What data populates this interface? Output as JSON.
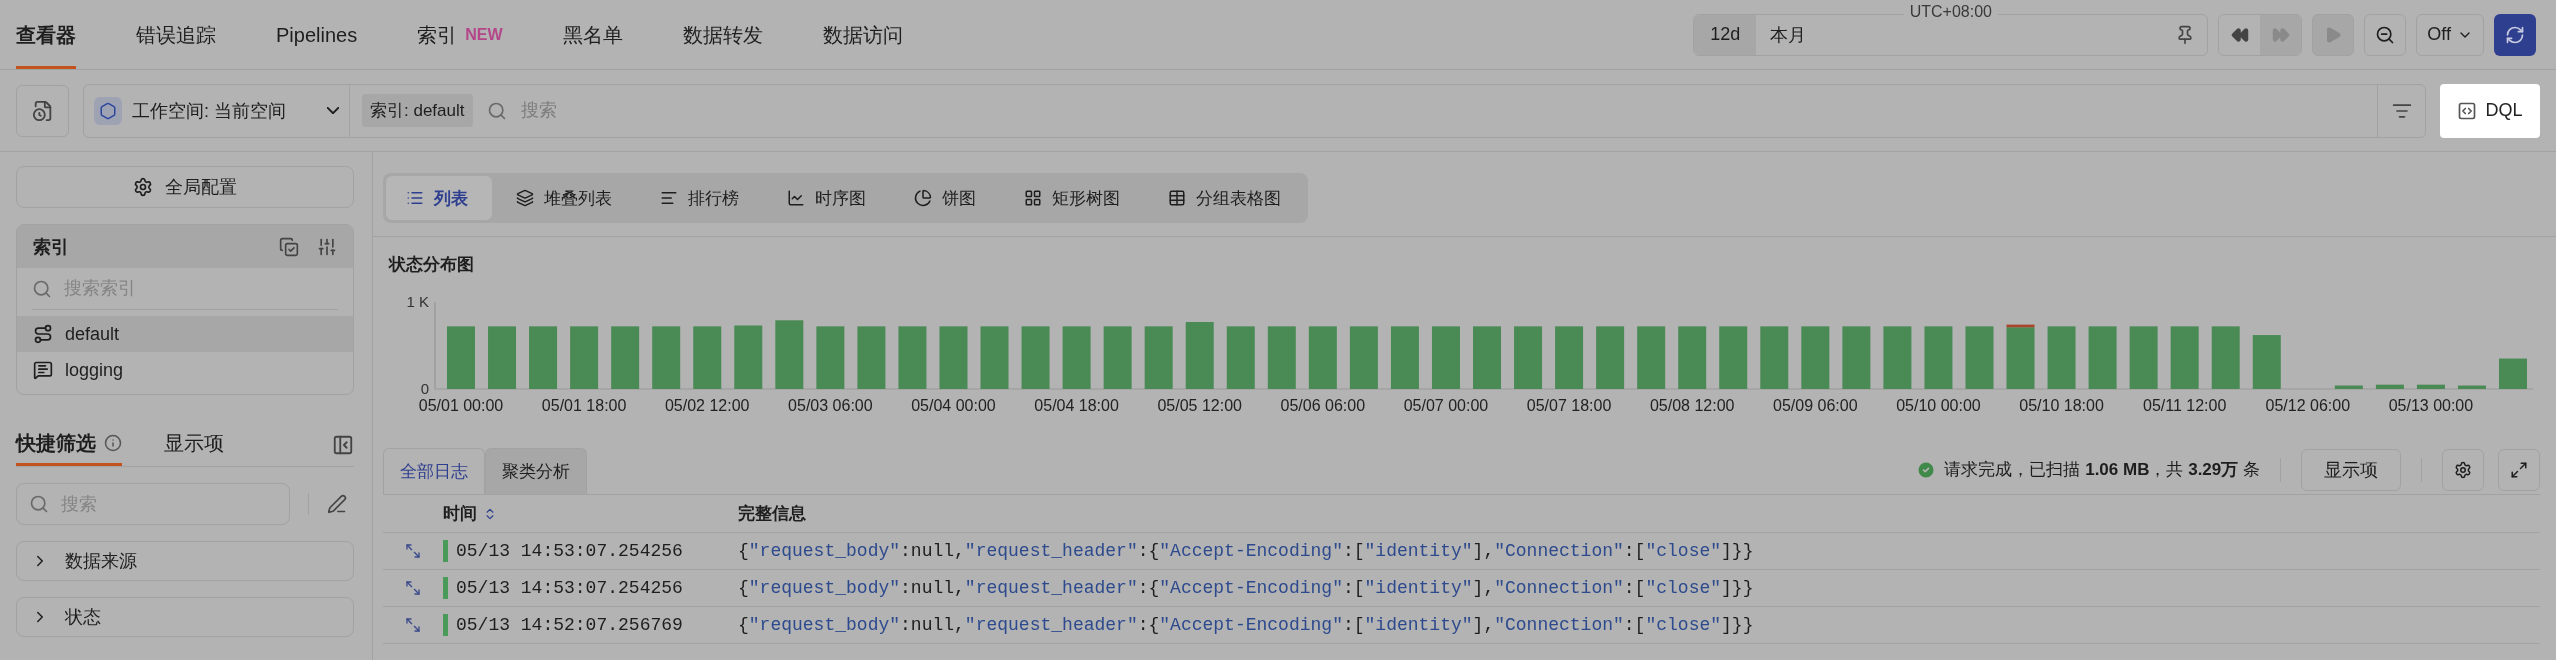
{
  "nav_tabs": [
    {
      "label": "查看器",
      "selected": true
    },
    {
      "label": "错误追踪",
      "selected": false
    },
    {
      "label": "Pipelines",
      "selected": false
    },
    {
      "label": "索引",
      "badge": "NEW",
      "selected": false
    },
    {
      "label": "黑名单",
      "selected": false
    },
    {
      "label": "数据转发",
      "selected": false
    },
    {
      "label": "数据访问",
      "selected": false
    }
  ],
  "time_range": {
    "timezone": "UTC+08:00",
    "duration": "12d",
    "value": "本月"
  },
  "refresh_mode": "Off",
  "query_bar": {
    "workspace": "工作空间: 当前空间",
    "index_chip": "索引: default",
    "placeholder": "搜索"
  },
  "dql_button": "DQL",
  "sidebar": {
    "global_config": "全局配置",
    "index_panel": {
      "title": "索引",
      "search_placeholder": "搜索索引",
      "items": [
        {
          "name": "default",
          "kind": "route",
          "selected": true
        },
        {
          "name": "logging",
          "kind": "log",
          "selected": false
        }
      ]
    },
    "filter_tabs": [
      {
        "label": "快捷筛选",
        "info": true,
        "selected": true
      },
      {
        "label": "显示项",
        "info": false,
        "selected": false
      }
    ],
    "filter_search_placeholder": "搜索",
    "facets": [
      {
        "label": "数据来源",
        "expanded": false
      },
      {
        "label": "状态",
        "expanded": false
      }
    ]
  },
  "view_tabs": [
    {
      "label": "列表",
      "kind": "list",
      "selected": true
    },
    {
      "label": "堆叠列表",
      "kind": "stack",
      "selected": false
    },
    {
      "label": "排行榜",
      "kind": "rank",
      "selected": false
    },
    {
      "label": "时序图",
      "kind": "timeseries",
      "selected": false
    },
    {
      "label": "饼图",
      "kind": "pie",
      "selected": false
    },
    {
      "label": "矩形树图",
      "kind": "treemap",
      "selected": false
    },
    {
      "label": "分组表格图",
      "kind": "table",
      "selected": false
    }
  ],
  "chart": {
    "title": "状态分布图",
    "chart_data": {
      "type": "bar",
      "stacked": true,
      "ylim": [
        0,
        1000
      ],
      "yticks": [
        {
          "value": 0,
          "label": "0"
        },
        {
          "value": 1000,
          "label": "1 K"
        }
      ],
      "categories": [
        "05/01 00:00",
        null,
        null,
        "05/01 18:00",
        null,
        null,
        "05/02 12:00",
        null,
        null,
        "05/03 06:00",
        null,
        null,
        "05/04 00:00",
        null,
        null,
        "05/04 18:00",
        null,
        null,
        "05/05 12:00",
        null,
        null,
        "05/06 06:00",
        null,
        null,
        "05/07 00:00",
        null,
        null,
        "05/07 18:00",
        null,
        null,
        "05/08 12:00",
        null,
        null,
        "05/09 06:00",
        null,
        null,
        "05/10 00:00",
        null,
        null,
        "05/10 18:00",
        null,
        null,
        "05/11 12:00",
        null,
        null,
        "05/12 06:00",
        null,
        null,
        "05/13 00:00",
        null,
        null
      ],
      "series": [
        {
          "color": "#4a8a55",
          "values": [
            720,
            720,
            720,
            720,
            720,
            720,
            720,
            730,
            790,
            720,
            720,
            720,
            720,
            720,
            720,
            720,
            720,
            720,
            770,
            720,
            720,
            720,
            720,
            720,
            720,
            720,
            720,
            720,
            720,
            720,
            720,
            720,
            720,
            720,
            720,
            720,
            720,
            720,
            710,
            720,
            720,
            720,
            720,
            720,
            620,
            0,
            40,
            50,
            50,
            40,
            350
          ]
        },
        {
          "color": "#a8452a",
          "values": [
            0,
            0,
            0,
            0,
            0,
            0,
            0,
            0,
            0,
            0,
            0,
            0,
            0,
            0,
            0,
            0,
            0,
            0,
            0,
            0,
            0,
            0,
            0,
            0,
            0,
            0,
            0,
            0,
            0,
            0,
            0,
            0,
            0,
            0,
            0,
            0,
            0,
            0,
            30,
            0,
            0,
            0,
            0,
            0,
            0,
            0,
            0,
            0,
            0,
            0,
            0
          ]
        }
      ]
    }
  },
  "result_tabs": [
    {
      "label": "全部日志",
      "selected": true
    },
    {
      "label": "聚类分析",
      "selected": false
    }
  ],
  "status_text": "请求完成，已扫描 **1.06 MB**，共 **3.29万** 条",
  "display_button": "显示项",
  "table": {
    "columns": [
      "时间",
      "完整信息"
    ],
    "rows": [
      {
        "time": "05/13 14:53:07.254256",
        "color": "#4a9a5a",
        "message": "{\"request_body\":null,\"request_header\":{\"Accept-Encoding\":[\"identity\"],\"Connection\":[\"close\"]}}"
      },
      {
        "time": "05/13 14:53:07.254256",
        "color": "#4a9a5a",
        "message": "{\"request_body\":null,\"request_header\":{\"Accept-Encoding\":[\"identity\"],\"Connection\":[\"close\"]}}"
      },
      {
        "time": "05/13 14:52:07.256769",
        "color": "#4a9a5a",
        "message": "{\"request_body\":null,\"request_header\":{\"Accept-Encoding\":[\"identity\"],\"Connection\":[\"close\"]}}"
      }
    ]
  }
}
